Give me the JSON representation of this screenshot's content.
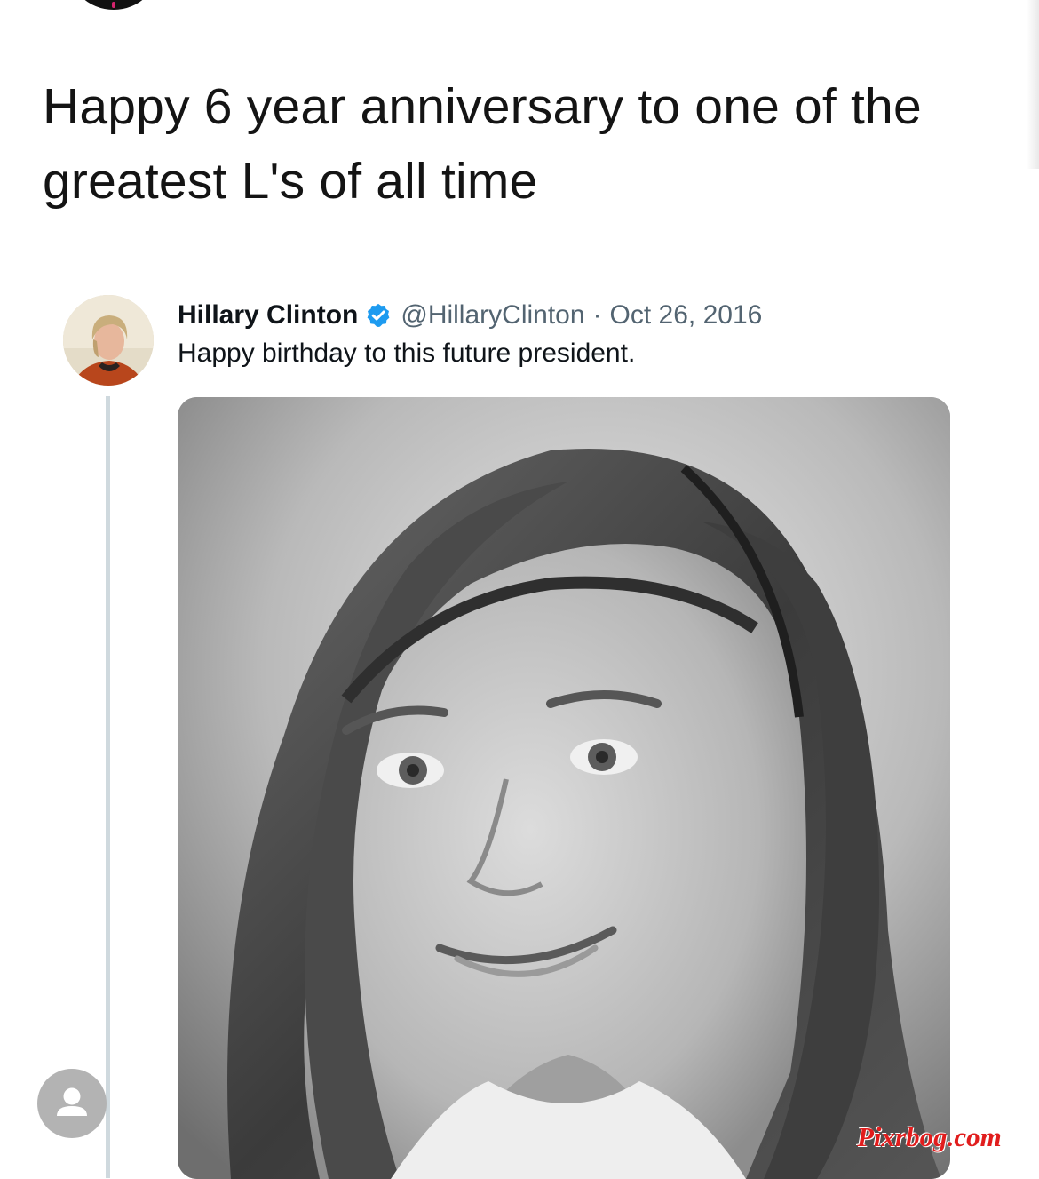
{
  "tweet": {
    "text": "Happy 6 year anniversary to one of the greatest L's of all time"
  },
  "quoted_tweet": {
    "author_name": "Hillary Clinton",
    "handle": "@HillaryClinton",
    "separator": "·",
    "date": "Oct 26, 2016",
    "text": "Happy birthday to this future president."
  },
  "watermark": "Pixrbog.com",
  "icons": {
    "verified": "verified-badge-icon",
    "user": "user-icon"
  },
  "colors": {
    "verified_blue": "#1d9bf0",
    "thread_line": "#cfd9de",
    "secondary_text": "#536471",
    "watermark_red": "#e11d1d"
  }
}
